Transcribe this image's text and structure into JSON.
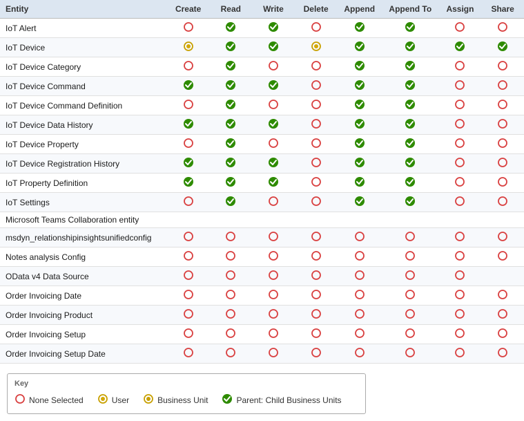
{
  "columns": [
    "Entity",
    "Create",
    "Read",
    "Write",
    "Delete",
    "Append",
    "Append To",
    "Assign",
    "Share"
  ],
  "rows": [
    {
      "entity": "IoT Alert",
      "create": "empty",
      "read": "parent",
      "write": "parent",
      "delete": "empty",
      "append": "parent",
      "appendTo": "parent",
      "assign": "empty",
      "share": "empty"
    },
    {
      "entity": "IoT Device",
      "create": "user",
      "read": "parent",
      "write": "parent",
      "delete": "user",
      "append": "parent",
      "appendTo": "parent",
      "assign": "parent",
      "share": "parent"
    },
    {
      "entity": "IoT Device Category",
      "create": "empty",
      "read": "parent",
      "write": "empty",
      "delete": "empty",
      "append": "parent",
      "appendTo": "parent",
      "assign": "empty",
      "share": "empty"
    },
    {
      "entity": "IoT Device Command",
      "create": "parent",
      "read": "parent",
      "write": "parent",
      "delete": "empty",
      "append": "parent",
      "appendTo": "parent",
      "assign": "empty",
      "share": "empty"
    },
    {
      "entity": "IoT Device Command Definition",
      "create": "empty",
      "read": "parent",
      "write": "empty",
      "delete": "empty",
      "append": "parent",
      "appendTo": "parent",
      "assign": "empty",
      "share": "empty"
    },
    {
      "entity": "IoT Device Data History",
      "create": "parent",
      "read": "parent",
      "write": "parent",
      "delete": "empty",
      "append": "parent",
      "appendTo": "parent",
      "assign": "empty",
      "share": "empty"
    },
    {
      "entity": "IoT Device Property",
      "create": "empty",
      "read": "parent",
      "write": "empty",
      "delete": "empty",
      "append": "parent",
      "appendTo": "parent",
      "assign": "empty",
      "share": "empty"
    },
    {
      "entity": "IoT Device Registration History",
      "create": "parent",
      "read": "parent",
      "write": "parent",
      "delete": "empty",
      "append": "parent",
      "appendTo": "parent",
      "assign": "empty",
      "share": "empty"
    },
    {
      "entity": "IoT Property Definition",
      "create": "parent",
      "read": "parent",
      "write": "parent",
      "delete": "empty",
      "append": "parent",
      "appendTo": "parent",
      "assign": "empty",
      "share": "empty"
    },
    {
      "entity": "IoT Settings",
      "create": "empty",
      "read": "parent",
      "write": "empty",
      "delete": "empty",
      "append": "parent",
      "appendTo": "parent",
      "assign": "empty",
      "share": "empty"
    },
    {
      "entity": "Microsoft Teams Collaboration entity",
      "create": "",
      "read": "",
      "write": "",
      "delete": "",
      "append": "",
      "appendTo": "",
      "assign": "",
      "share": ""
    },
    {
      "entity": "msdyn_relationshipinsightsunifiedconfig",
      "create": "empty",
      "read": "empty",
      "write": "empty",
      "delete": "empty",
      "append": "empty",
      "appendTo": "empty",
      "assign": "empty",
      "share": "empty"
    },
    {
      "entity": "Notes analysis Config",
      "create": "empty",
      "read": "empty",
      "write": "empty",
      "delete": "empty",
      "append": "empty",
      "appendTo": "empty",
      "assign": "empty",
      "share": "empty"
    },
    {
      "entity": "OData v4 Data Source",
      "create": "empty",
      "read": "empty",
      "write": "empty",
      "delete": "empty",
      "append": "empty",
      "appendTo": "empty",
      "assign": "empty",
      "share": ""
    },
    {
      "entity": "Order Invoicing Date",
      "create": "empty",
      "read": "empty",
      "write": "empty",
      "delete": "empty",
      "append": "empty",
      "appendTo": "empty",
      "assign": "empty",
      "share": "empty"
    },
    {
      "entity": "Order Invoicing Product",
      "create": "empty",
      "read": "empty",
      "write": "empty",
      "delete": "empty",
      "append": "empty",
      "appendTo": "empty",
      "assign": "empty",
      "share": "empty"
    },
    {
      "entity": "Order Invoicing Setup",
      "create": "empty",
      "read": "empty",
      "write": "empty",
      "delete": "empty",
      "append": "empty",
      "appendTo": "empty",
      "assign": "empty",
      "share": "empty"
    },
    {
      "entity": "Order Invoicing Setup Date",
      "create": "empty",
      "read": "empty",
      "write": "empty",
      "delete": "empty",
      "append": "empty",
      "appendTo": "empty",
      "assign": "empty",
      "share": "empty"
    }
  ],
  "key": {
    "title": "Key",
    "items": [
      {
        "type": "empty",
        "label": "None Selected"
      },
      {
        "type": "user",
        "label": "User"
      },
      {
        "type": "bu",
        "label": "Business Unit"
      },
      {
        "type": "parent",
        "label": "Parent: Child Business Units"
      }
    ]
  }
}
